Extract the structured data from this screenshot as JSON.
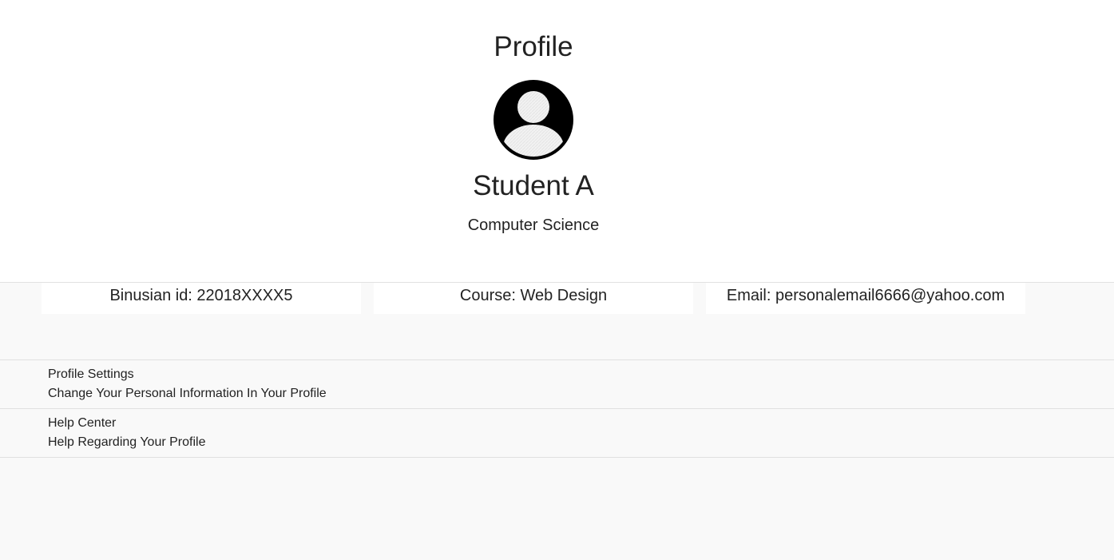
{
  "header": {
    "title": "Profile",
    "avatar_icon": "user-avatar-icon",
    "student_name": "Student A",
    "major": "Computer Science"
  },
  "info_cards": [
    {
      "text": "Binusian id: 22018XXXX5"
    },
    {
      "text": "Course: Web Design"
    },
    {
      "text": "Email: personalemail6666@yahoo.com"
    }
  ],
  "menu": [
    {
      "title": "Profile Settings",
      "subtitle": "Change Your Personal Information In Your Profile"
    },
    {
      "title": "Help Center",
      "subtitle": "Help Regarding Your Profile"
    }
  ],
  "colors": {
    "page_background": "#f9f9f9",
    "header_background": "#ffffff",
    "text": "#222222",
    "avatar": "#000000"
  }
}
